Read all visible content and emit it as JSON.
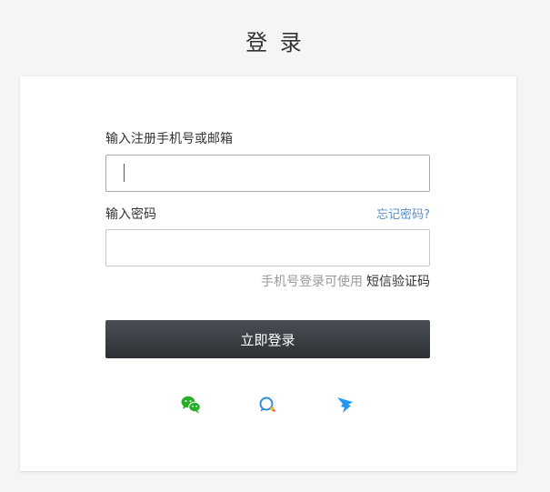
{
  "page": {
    "title": "登 录"
  },
  "form": {
    "account_label": "输入注册手机号或邮箱",
    "account_value": "",
    "password_label": "输入密码",
    "password_value": "",
    "forgot_password": "忘记密码?",
    "sms_prefix": "手机号登录可使用",
    "sms_link": "短信验证码",
    "submit_label": "立即登录"
  },
  "social_login": [
    {
      "icon": "wechat-icon",
      "color": "#2aae2a"
    },
    {
      "icon": "chat-bubble-icon",
      "color": "#2f8fd8"
    },
    {
      "icon": "dingtalk-icon",
      "color": "#2196f3"
    }
  ],
  "colors": {
    "accent_link": "#5b8ec9",
    "button_bg": "#2f3338",
    "page_bg": "#f5f5f5"
  }
}
